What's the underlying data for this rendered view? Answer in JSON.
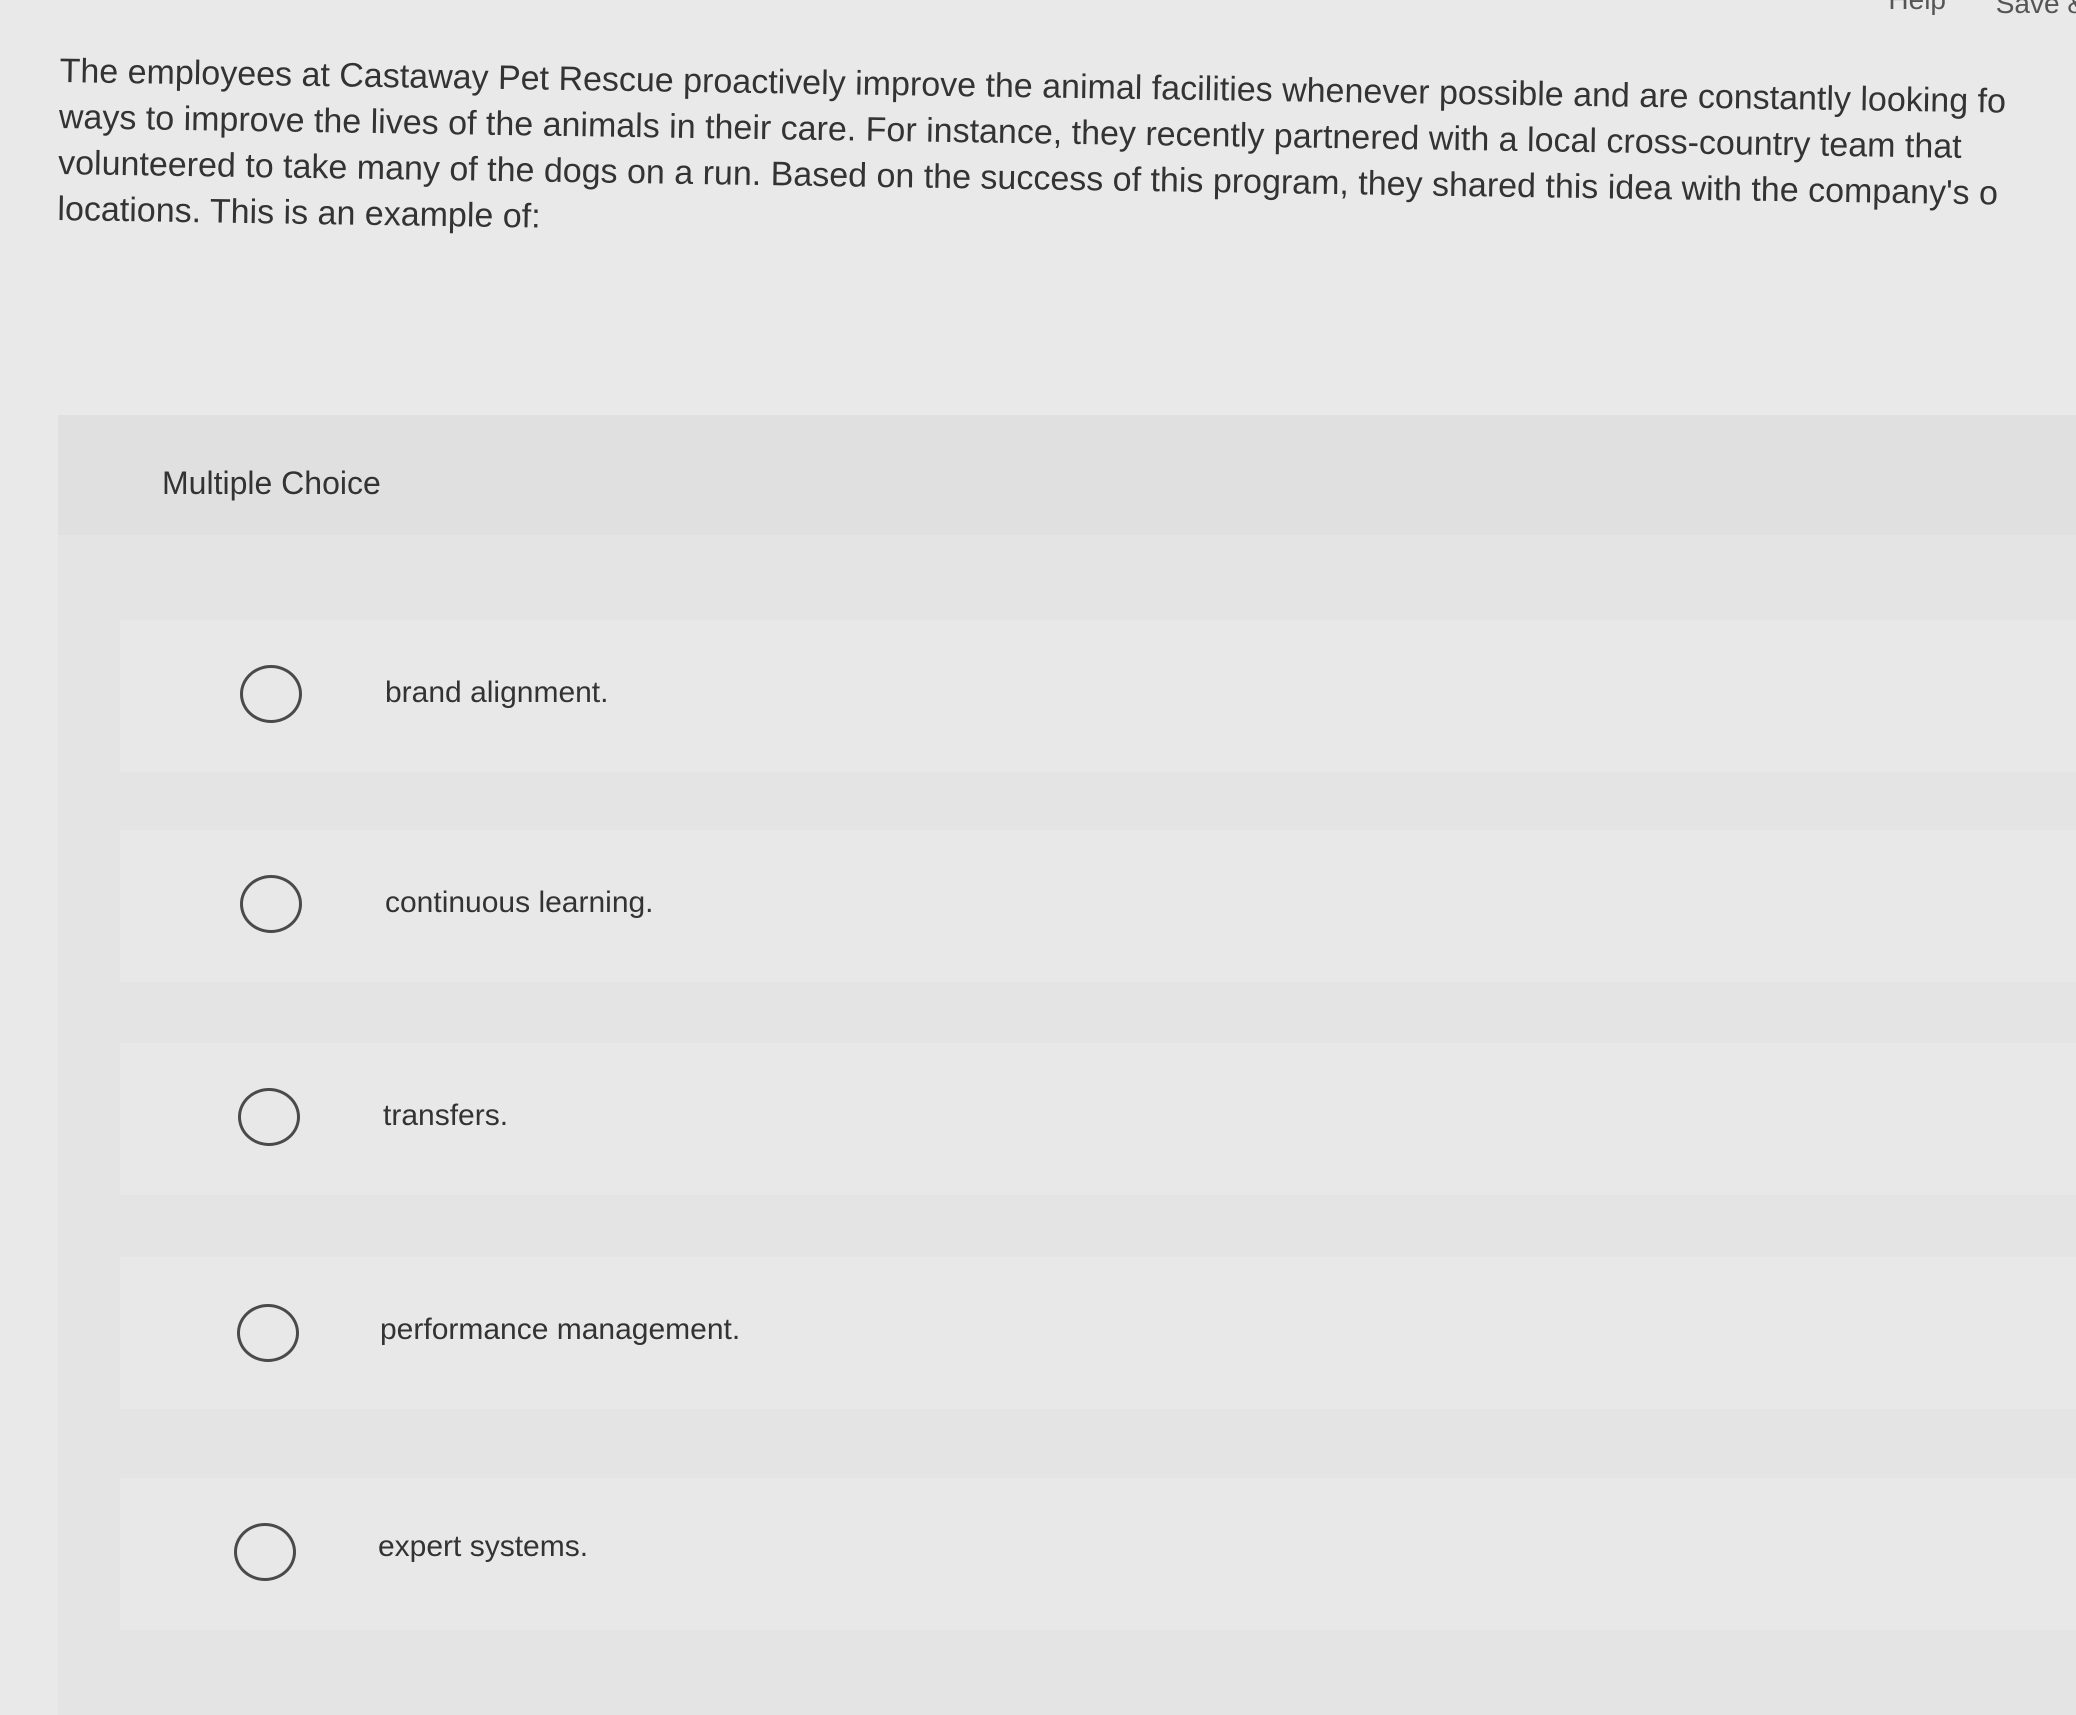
{
  "topbar": {
    "help_label": "Help",
    "save_label": "Save &"
  },
  "question": {
    "lines": [
      "The employees at Castaway Pet Rescue proactively improve the animal facilities whenever possible and are constantly looking fo",
      "ways to improve the lives of the animals in their care. For instance, they recently partnered with a local cross-country team that",
      "volunteered to take many of the dogs on a run. Based on the success of this program, they shared this idea with the company's o",
      "locations. This is an example of:"
    ]
  },
  "panel": {
    "title": "Multiple Choice",
    "options": [
      {
        "label": "brand alignment."
      },
      {
        "label": "continuous learning."
      },
      {
        "label": "transfers."
      },
      {
        "label": "performance management."
      },
      {
        "label": "expert systems."
      }
    ]
  }
}
